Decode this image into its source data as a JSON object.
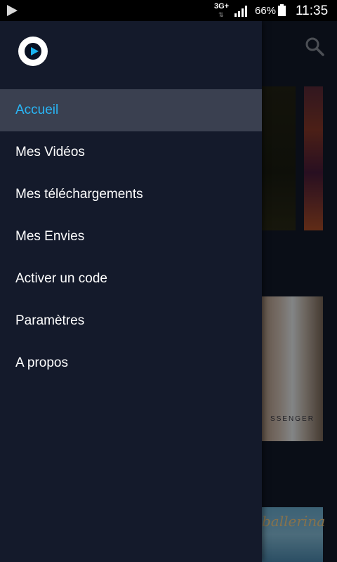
{
  "status_bar": {
    "network": "3G+",
    "network_arrows": "⇅",
    "battery_percent": "66%",
    "time": "11:35"
  },
  "background": {
    "posters": [
      {
        "title_text": "SSENGER"
      },
      {
        "title_text": "ballerina"
      }
    ]
  },
  "drawer": {
    "menu_items": [
      {
        "label": "Accueil",
        "active": true
      },
      {
        "label": "Mes Vidéos"
      },
      {
        "label": "Mes téléchargements"
      },
      {
        "label": "Mes Envies"
      },
      {
        "label": "Activer un code"
      },
      {
        "label": "Paramètres"
      },
      {
        "label": "A propos"
      }
    ]
  },
  "colors": {
    "drawer_bg": "#141a2b",
    "active_item_bg": "#3a4050",
    "accent": "#29b6f6"
  }
}
